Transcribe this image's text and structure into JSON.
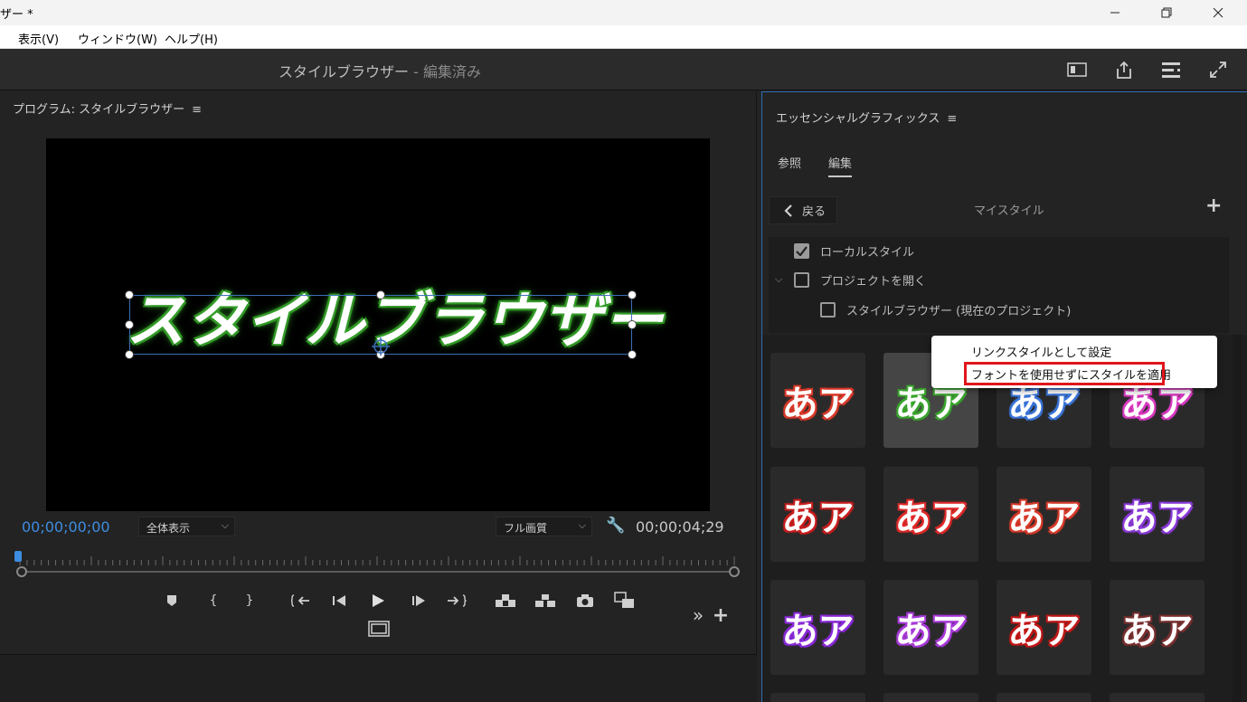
{
  "window": {
    "title": "ザー *",
    "minimize_icon": "minimize-icon",
    "maximize_icon": "restore-icon",
    "close_icon": "close-icon"
  },
  "menubar": {
    "items": [
      "表示(V)",
      "ウィンドウ(W)",
      "ヘルプ(H)"
    ]
  },
  "header": {
    "title": "スタイルブラウザー",
    "separator": " - ",
    "status": "編集済み"
  },
  "program_monitor": {
    "title": "プログラム: スタイルブラウザー",
    "menu_icon": "≡",
    "overlay_text": "スタイルブラウザー",
    "timecode_current": "00;00;00;00",
    "timecode_duration": "00;00;04;29",
    "zoom_select": "全体表示",
    "quality_select": "フル画質",
    "playhead_fraction": 0.0,
    "transport": {
      "add_marker": "◆",
      "mark_in": "{",
      "mark_out": "}",
      "go_to_in": "{←",
      "step_back": "◀",
      "play": "▶",
      "step_forward": "▶",
      "go_to_out": "→}",
      "lift": "lift",
      "extract": "extract",
      "export_frame": "camera",
      "compare": "compare",
      "safe_margins": "safe-margins",
      "more": "»",
      "add": "+"
    },
    "accent_color": "#3d8de0"
  },
  "essential_graphics": {
    "title": "エッセンシャルグラフィックス",
    "menu_icon": "≡",
    "tabs": [
      {
        "label": "参照",
        "active": false
      },
      {
        "label": "編集",
        "active": true
      }
    ],
    "back_label": "戻る",
    "section_title": "マイスタイル",
    "add_icon": "+",
    "sources": [
      {
        "label": "ローカルスタイル",
        "checked": true
      },
      {
        "label": "プロジェクトを開く",
        "checked": false,
        "expanded": true
      },
      {
        "label": "スタイルブラウザー (現在のプロジェクト)",
        "checked": false
      }
    ],
    "style_tiles": [
      {
        "text": "あア",
        "color": "#d83a2a"
      },
      {
        "text": "あア",
        "color": "#3aa52e"
      },
      {
        "text": "あア",
        "color": "#3a74d8"
      },
      {
        "text": "あア",
        "color": "#d83ac0"
      },
      {
        "text": "あア",
        "color": "#c81e1e"
      },
      {
        "text": "あア",
        "color": "#e02a2a"
      },
      {
        "text": "あア",
        "color": "#d63a2a"
      },
      {
        "text": "あア",
        "color": "#8a3ad8"
      },
      {
        "text": "あア",
        "color": "#8a2ad8"
      },
      {
        "text": "あア",
        "color": "#a83ad8"
      },
      {
        "text": "あア",
        "color": "#c01818"
      },
      {
        "text": "あア",
        "color": "#7a3030"
      }
    ],
    "selected_tile": 1,
    "panel_accent": "#2e6db6"
  },
  "context_menu": {
    "items": [
      "リンクスタイルとして設定",
      "フォントを使用せずにスタイルを適用"
    ],
    "highlighted_index": 1,
    "highlight_color": "#e0161b"
  }
}
